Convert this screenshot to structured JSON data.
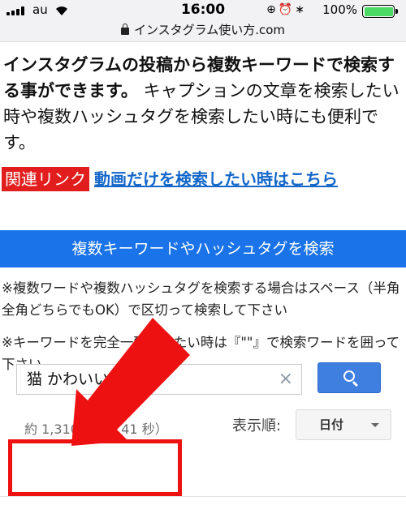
{
  "status": {
    "carrier": "au",
    "time": "16:00",
    "battery": "100%",
    "battery_level": 1.0
  },
  "url": {
    "text": "インスタグラム使い方.com"
  },
  "intro": {
    "bold": "インスタグラムの投稿から複数キーワードで検索する事ができます。",
    "normal": " キャプションの文章を検索したい時や複数ハッシュタグを検索したい時にも便利です。"
  },
  "related": {
    "badge": "関連リンク",
    "link": "動画だけを検索したい時はこちら"
  },
  "search": {
    "banner": "複数キーワードやハッシュタグを検索",
    "note1": "※複数ワードや複数ハッシュタグを検索する場合はスペース（半角全角どちらでもOK）で区切って検索して下さい",
    "note2": "※キーワードを完全一致させたい時は『\"\"』で検索ワードを囲って下さい",
    "query": "猫 かわいい",
    "clear": "×"
  },
  "results": {
    "count": "約 1,310 件（0.41 秒）",
    "sort_label": "表示順:",
    "sort_value": "日付"
  },
  "colors": {
    "accent": "#1a73e8",
    "badge": "#e21d1d",
    "annotation": "#ee1111"
  }
}
